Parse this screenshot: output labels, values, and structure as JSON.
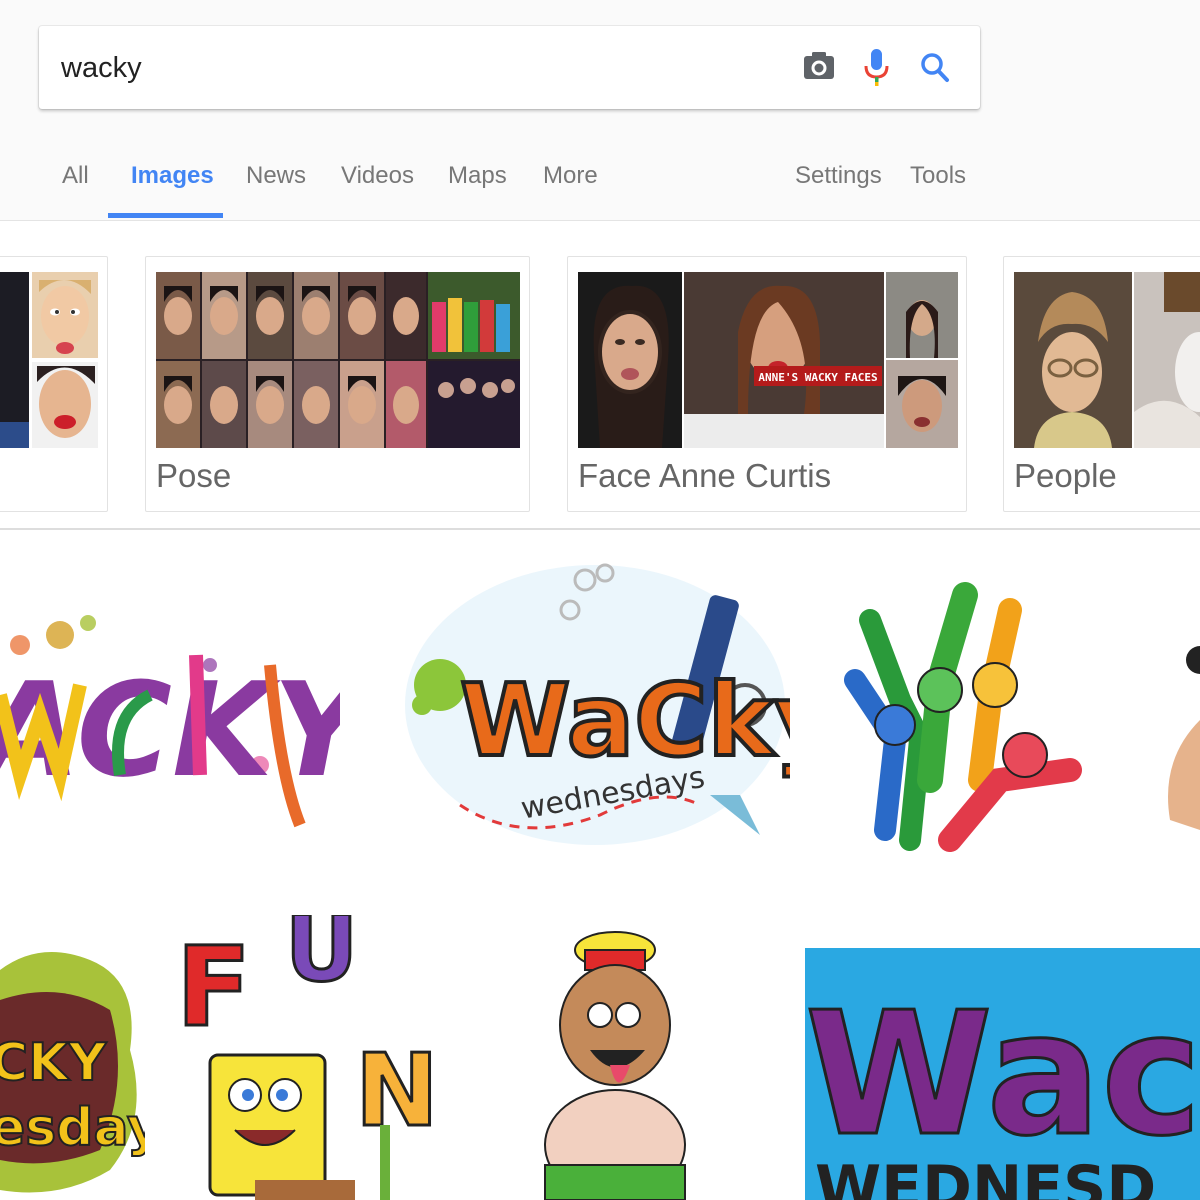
{
  "search": {
    "query": "wacky",
    "camera_icon": "camera-icon",
    "mic_icon": "microphone-icon",
    "search_icon": "search-icon"
  },
  "tabs": [
    {
      "label": "All",
      "active": false
    },
    {
      "label": "Images",
      "active": true
    },
    {
      "label": "News",
      "active": false
    },
    {
      "label": "Videos",
      "active": false
    },
    {
      "label": "Maps",
      "active": false
    },
    {
      "label": "More",
      "active": false
    }
  ],
  "tools": [
    {
      "label": "Settings"
    },
    {
      "label": "Tools"
    }
  ],
  "related": [
    {
      "label": ""
    },
    {
      "label": "Pose"
    },
    {
      "label": "Face Anne Curtis",
      "overlay_text": "ANNE'S WACKY FACES"
    },
    {
      "label": "People"
    }
  ],
  "results": [
    {
      "text": "ACKY"
    },
    {
      "text_main": "WaCky",
      "text_sub": "wednesdays"
    },
    {
      "text": ""
    },
    {
      "text": ""
    },
    {
      "text_main": "CKY",
      "text_sub": "esday"
    },
    {
      "text": "FUN"
    },
    {
      "text": ""
    },
    {
      "text_main": "Wack",
      "text_sub": "WEDNESD"
    }
  ],
  "colors": {
    "accent": "#4285f4",
    "tab_inactive": "#777777",
    "header_bg": "#fafafa"
  }
}
